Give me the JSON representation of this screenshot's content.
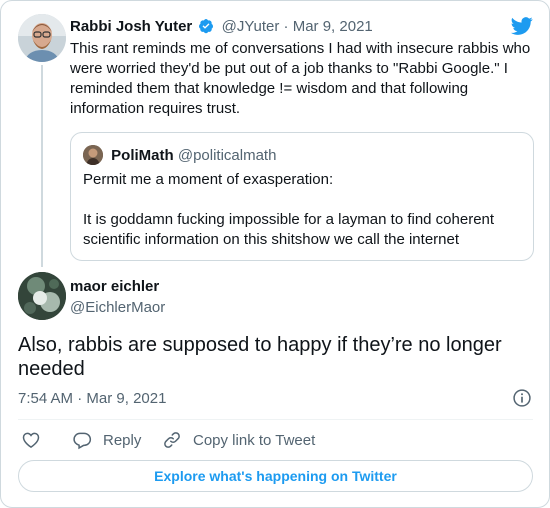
{
  "colors": {
    "accent": "#1d9bf0",
    "text": "#0f1419",
    "muted": "#536471",
    "border": "#cfd9de"
  },
  "parent_tweet": {
    "name": "Rabbi Josh Yuter",
    "verified_icon": "verified-badge-icon",
    "handle": "@JYuter",
    "separator": "·",
    "date": "Mar 9, 2021",
    "text": "This rant reminds me of conversations I had with insecure rabbis who were worried they'd be put out of a job thanks to \"Rabbi Google.\" I reminded them that knowledge != wisdom and that following information requires trust.",
    "quoted": {
      "name": "PoliMath",
      "handle": "@politicalmath",
      "line1": "Permit me a moment of exasperation:",
      "line2": "It is goddamn fucking impossible for a layman to find coherent scientific information on this shitshow we call the internet"
    }
  },
  "main_tweet": {
    "name": "maor eichler",
    "handle": "@EichlerMaor",
    "text": "Also, rabbis are supposed to happy if they’re no longer needed",
    "time": "7:54 AM",
    "separator": "·",
    "date": "Mar 9, 2021"
  },
  "actions": {
    "like_icon": "heart-icon",
    "reply_label": "Reply",
    "copy_label": "Copy link to Tweet"
  },
  "explore_label": "Explore what's happening on Twitter"
}
